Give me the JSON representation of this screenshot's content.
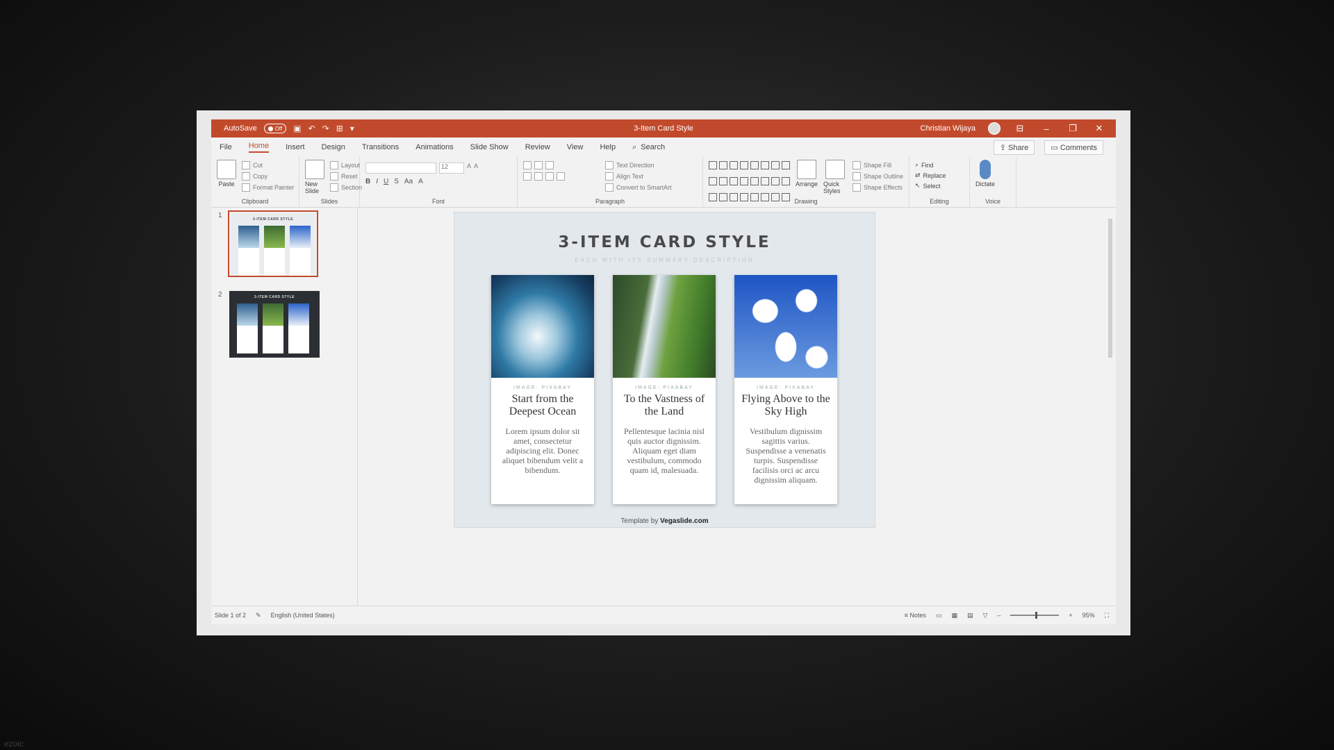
{
  "app": {
    "autosave_label": "AutoSave",
    "autosave_state": "Off",
    "doc_title": "3-Item Card Style",
    "user_name": "Christian Wijaya"
  },
  "tabs": [
    "File",
    "Home",
    "Insert",
    "Design",
    "Transitions",
    "Animations",
    "Slide Show",
    "Review",
    "View",
    "Help"
  ],
  "search_label": "Search",
  "share_label": "Share",
  "comments_label": "Comments",
  "ribbon": {
    "clipboard": {
      "paste": "Paste",
      "cut": "Cut",
      "copy": "Copy",
      "format_painter": "Format Painter",
      "label": "Clipboard"
    },
    "slides": {
      "new_slide": "New Slide",
      "layout": "Layout",
      "reset": "Reset",
      "section": "Section",
      "label": "Slides"
    },
    "font": {
      "size": "12",
      "label": "Font"
    },
    "paragraph": {
      "text_direction": "Text Direction",
      "align_text": "Align Text",
      "convert": "Convert to SmartArt",
      "label": "Paragraph"
    },
    "drawing": {
      "arrange": "Arrange",
      "quick_styles": "Quick Styles",
      "shape_fill": "Shape Fill",
      "shape_outline": "Shape Outline",
      "shape_effects": "Shape Effects",
      "label": "Drawing"
    },
    "editing": {
      "find": "Find",
      "replace": "Replace",
      "select": "Select",
      "label": "Editing"
    },
    "voice": {
      "dictate": "Dictate",
      "label": "Voice"
    }
  },
  "thumbnails": [
    {
      "num": "1",
      "title": "3-ITEM CARD STYLE"
    },
    {
      "num": "2",
      "title": "3-ITEM CARD STYLE"
    }
  ],
  "slide": {
    "title": "3-ITEM CARD STYLE",
    "subtitle": "EACH WITH ITS SUMMARY DESCRIPTION",
    "cards": [
      {
        "credit": "IMAGE: PIXABAY",
        "title": "Start from the Deepest Ocean",
        "body": "Lorem ipsum dolor sit amet, consectetur adipiscing elit. Donec aliquet bibendum velit a bibendum."
      },
      {
        "credit": "IMAGE: PIXABAY",
        "title": "To the Vastness of the Land",
        "body": "Pellentesque lacinia nisl quis auctor dignissim. Aliquam eget diam vestibulum, commodo quam id, malesuada."
      },
      {
        "credit": "IMAGE: PIXABAY",
        "title": "Flying Above to the Sky High",
        "body": "Vestibulum dignissim sagittis varius. Suspendisse a venenatis turpis. Suspendisse facilisis orci ac arcu dignissim aliquam."
      }
    ],
    "footer_prefix": "Template by",
    "footer_brand": "Vegaslide.com"
  },
  "status": {
    "slide_counter": "Slide 1 of 2",
    "language": "English (United States)",
    "notes": "Notes",
    "zoom": "95%"
  },
  "watermark": "ezoic",
  "colors": {
    "accent": "#c24a2c"
  }
}
